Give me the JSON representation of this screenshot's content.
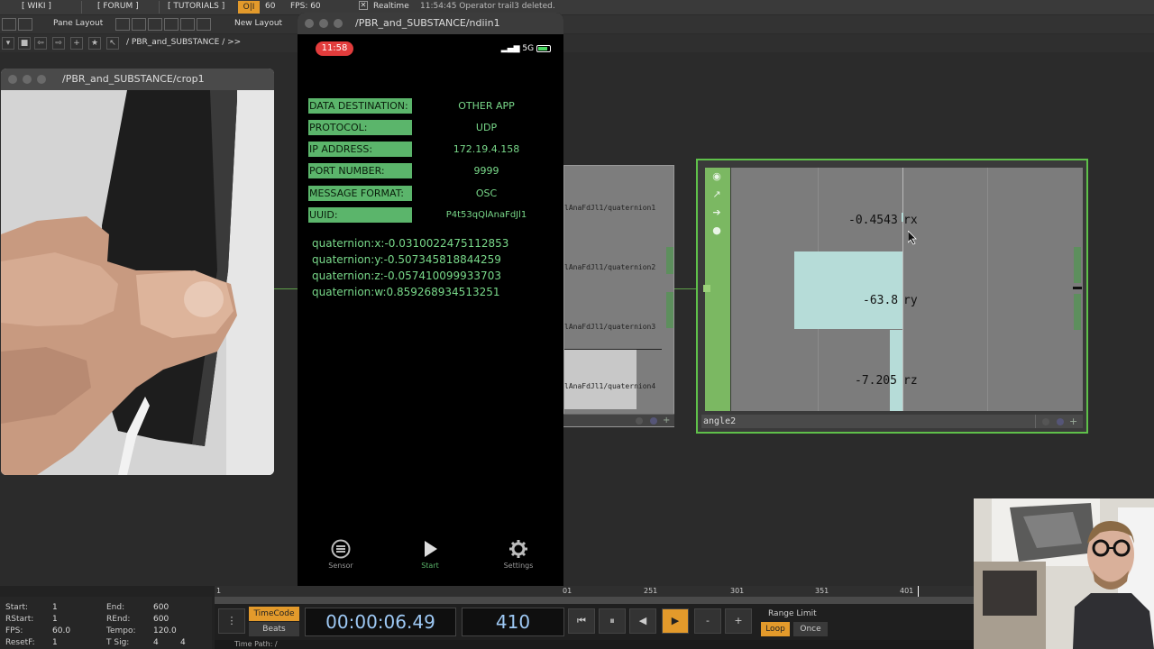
{
  "topbar": {
    "wiki": "[ WIKI ]",
    "forum": "[ FORUM ]",
    "tutorials": "[ TUTORIALS ]",
    "oi": "O|I",
    "sixty": "60",
    "fps": "FPS: 60",
    "realtime": "Realtime",
    "status": "11:54:45 Operator trail3 deleted."
  },
  "layoutbar": {
    "pane_layout": "Pane Layout",
    "new_layout": "New Layout"
  },
  "pathbar": {
    "path": "/ PBR_and_SUBSTANCE / >>"
  },
  "crop_window": {
    "title": "/PBR_and_SUBSTANCE/crop1"
  },
  "phone_window": {
    "title": "/PBR_and_SUBSTANCE/ndiin1",
    "clock": "11:58",
    "network": "5G",
    "rows": [
      {
        "label": "DATA DESTINATION:",
        "value": "OTHER APP"
      },
      {
        "label": "PROTOCOL:",
        "value": "UDP"
      },
      {
        "label": "IP ADDRESS:",
        "value": "172.19.4.158"
      },
      {
        "label": "PORT NUMBER:",
        "value": "9999"
      },
      {
        "label": "MESSAGE FORMAT:",
        "value": "OSC"
      },
      {
        "label": "UUID:",
        "value": "P4t53qQlAnaFdJl1"
      }
    ],
    "quaternions": [
      "quaternion:x:-0.0310022475112853",
      "quaternion:y:-0.507345818844259",
      "quaternion:z:-0.057410099933703",
      "quaternion:w:0.859268934513251"
    ],
    "tabs": {
      "sensor": "Sensor",
      "start": "Start",
      "settings": "Settings"
    }
  },
  "mid_node": {
    "channels": [
      "lAnaFdJl1/quaternion1",
      "lAnaFdJl1/quaternion2",
      "lAnaFdJl1/quaternion3",
      "lAnaFdJl1/quaternion4"
    ]
  },
  "angle_node": {
    "name": "angle2",
    "rx": "-0.4543",
    "ry": "-63.8",
    "rz": "-7.205",
    "rx_label": "rx",
    "ry_label": "ry",
    "rz_label": "rz"
  },
  "timeline": {
    "ticks": [
      "1",
      "01",
      "251",
      "301",
      "351",
      "401"
    ],
    "start_k": "Start:",
    "start_v": "1",
    "end_k": "End:",
    "end_v": "600",
    "rstart_k": "RStart:",
    "rstart_v": "1",
    "rend_k": "REnd:",
    "rend_v": "600",
    "fps_k": "FPS:",
    "fps_v": "60.0",
    "tempo_k": "Tempo:",
    "tempo_v": "120.0",
    "resetf_k": "ResetF:",
    "resetf_v": "1",
    "tsig_k": "T Sig:",
    "tsig_v1": "4",
    "tsig_v2": "4",
    "timecode": "TimeCode",
    "beats": "Beats",
    "time": "00:00:06.49",
    "frame": "410",
    "range_limit": "Range Limit",
    "loop": "Loop",
    "once": "Once",
    "time_path": "Time Path: /"
  }
}
